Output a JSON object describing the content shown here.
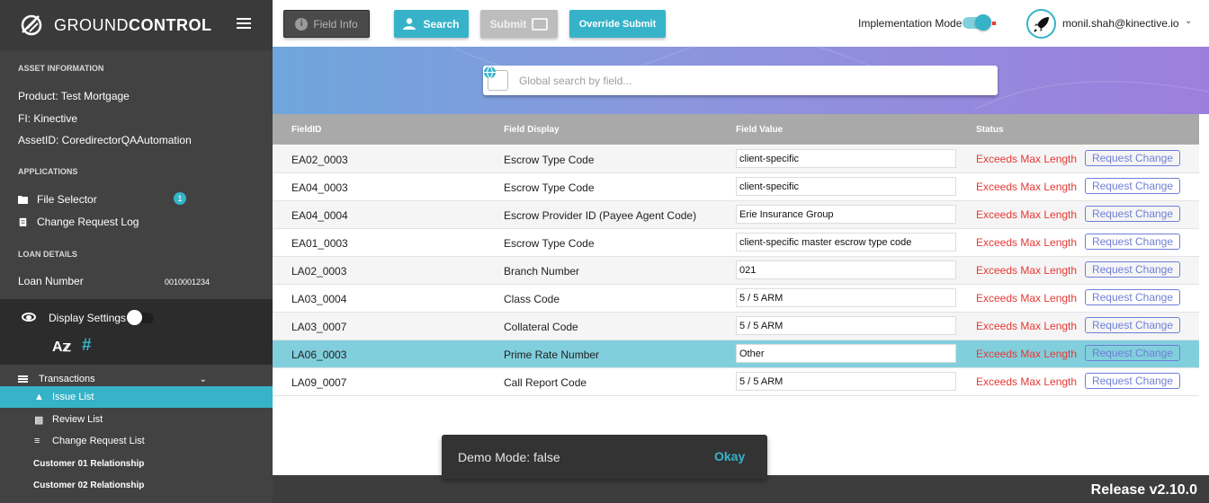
{
  "brand": {
    "name_light": "GROUND",
    "name_bold": "CONTROL"
  },
  "sidebar": {
    "asset_information": {
      "title": "ASSET INFORMATION",
      "product": "Product:  Test Mortgage",
      "fi": "FI:  Kinective",
      "asset_id": "AssetID:  CoredirectorQAAutomation"
    },
    "applications": {
      "title": "APPLICATIONS",
      "items": [
        {
          "label": "File Selector",
          "icon": "folder-icon",
          "badge": "1"
        },
        {
          "label": "Change Request Log",
          "icon": "clipboard-icon"
        }
      ]
    },
    "loan_details": {
      "title": "LOAN DETAILS",
      "loan_number_label": "Loan Number",
      "loan_number_value": "0010001234"
    },
    "display_settings": {
      "label": "Display Settings",
      "enabled": false
    },
    "transactions": {
      "label": "Transactions",
      "items": [
        {
          "label": "Issue List",
          "icon": "warning-icon",
          "active": true
        },
        {
          "label": "Review List",
          "icon": "review-icon"
        },
        {
          "label": "Change Request List",
          "icon": "change-list-icon"
        },
        {
          "label": "Customer 01 Relationship"
        },
        {
          "label": "Customer 02 Relationship"
        }
      ]
    }
  },
  "toolbar": {
    "field_info_label": "Field Info",
    "search_label": "Search",
    "submit_label": "Submit",
    "override_submit_label": "Override Submit",
    "implementation_mode_label": "Implementation Mode",
    "implementation_mode_on": true,
    "user_email": "monil.shah@kinective.io"
  },
  "search": {
    "placeholder": "Global search by field..."
  },
  "table": {
    "columns": [
      "FieldID",
      "Field Display",
      "Field Value",
      "Status"
    ],
    "rows": [
      {
        "id": "EA02_0003",
        "display": "Escrow Type Code",
        "value": "client-specific",
        "status": "Exceeds Max Length",
        "action": "Request Change"
      },
      {
        "id": "EA04_0003",
        "display": "Escrow Type Code",
        "value": "client-specific",
        "status": "Exceeds Max Length",
        "action": "Request Change"
      },
      {
        "id": "EA04_0004",
        "display": "Escrow Provider ID (Payee Agent Code)",
        "value": "Erie Insurance Group",
        "status": "Exceeds Max Length",
        "action": "Request Change"
      },
      {
        "id": "EA01_0003",
        "display": "Escrow Type Code",
        "value": "client-specific master escrow type code",
        "status": "Exceeds Max Length",
        "action": "Request Change"
      },
      {
        "id": "LA02_0003",
        "display": "Branch Number",
        "value": "021",
        "status": "Exceeds Max Length",
        "action": "Request Change"
      },
      {
        "id": "LA03_0004",
        "display": "Class Code",
        "value": "5 / 5 ARM",
        "status": "Exceeds Max Length",
        "action": "Request Change"
      },
      {
        "id": "LA03_0007",
        "display": "Collateral Code",
        "value": "5 / 5 ARM",
        "status": "Exceeds Max Length",
        "action": "Request Change"
      },
      {
        "id": "LA06_0003",
        "display": "Prime Rate Number",
        "value": "Other",
        "status": "Exceeds Max Length",
        "action": "Request Change",
        "selected": true
      },
      {
        "id": "LA09_0007",
        "display": "Call Report Code",
        "value": "5 / 5 ARM",
        "status": "Exceeds Max Length",
        "action": "Request Change"
      }
    ]
  },
  "snackbar": {
    "message": "Demo Mode: false",
    "action": "Okay"
  },
  "footer": {
    "release": "Release v2.10.0"
  },
  "colors": {
    "accent": "#36b3c8",
    "error": "#e53935",
    "sidebar": "#424242",
    "selected_row": "#81cfdd",
    "link": "#6f7ed6"
  }
}
